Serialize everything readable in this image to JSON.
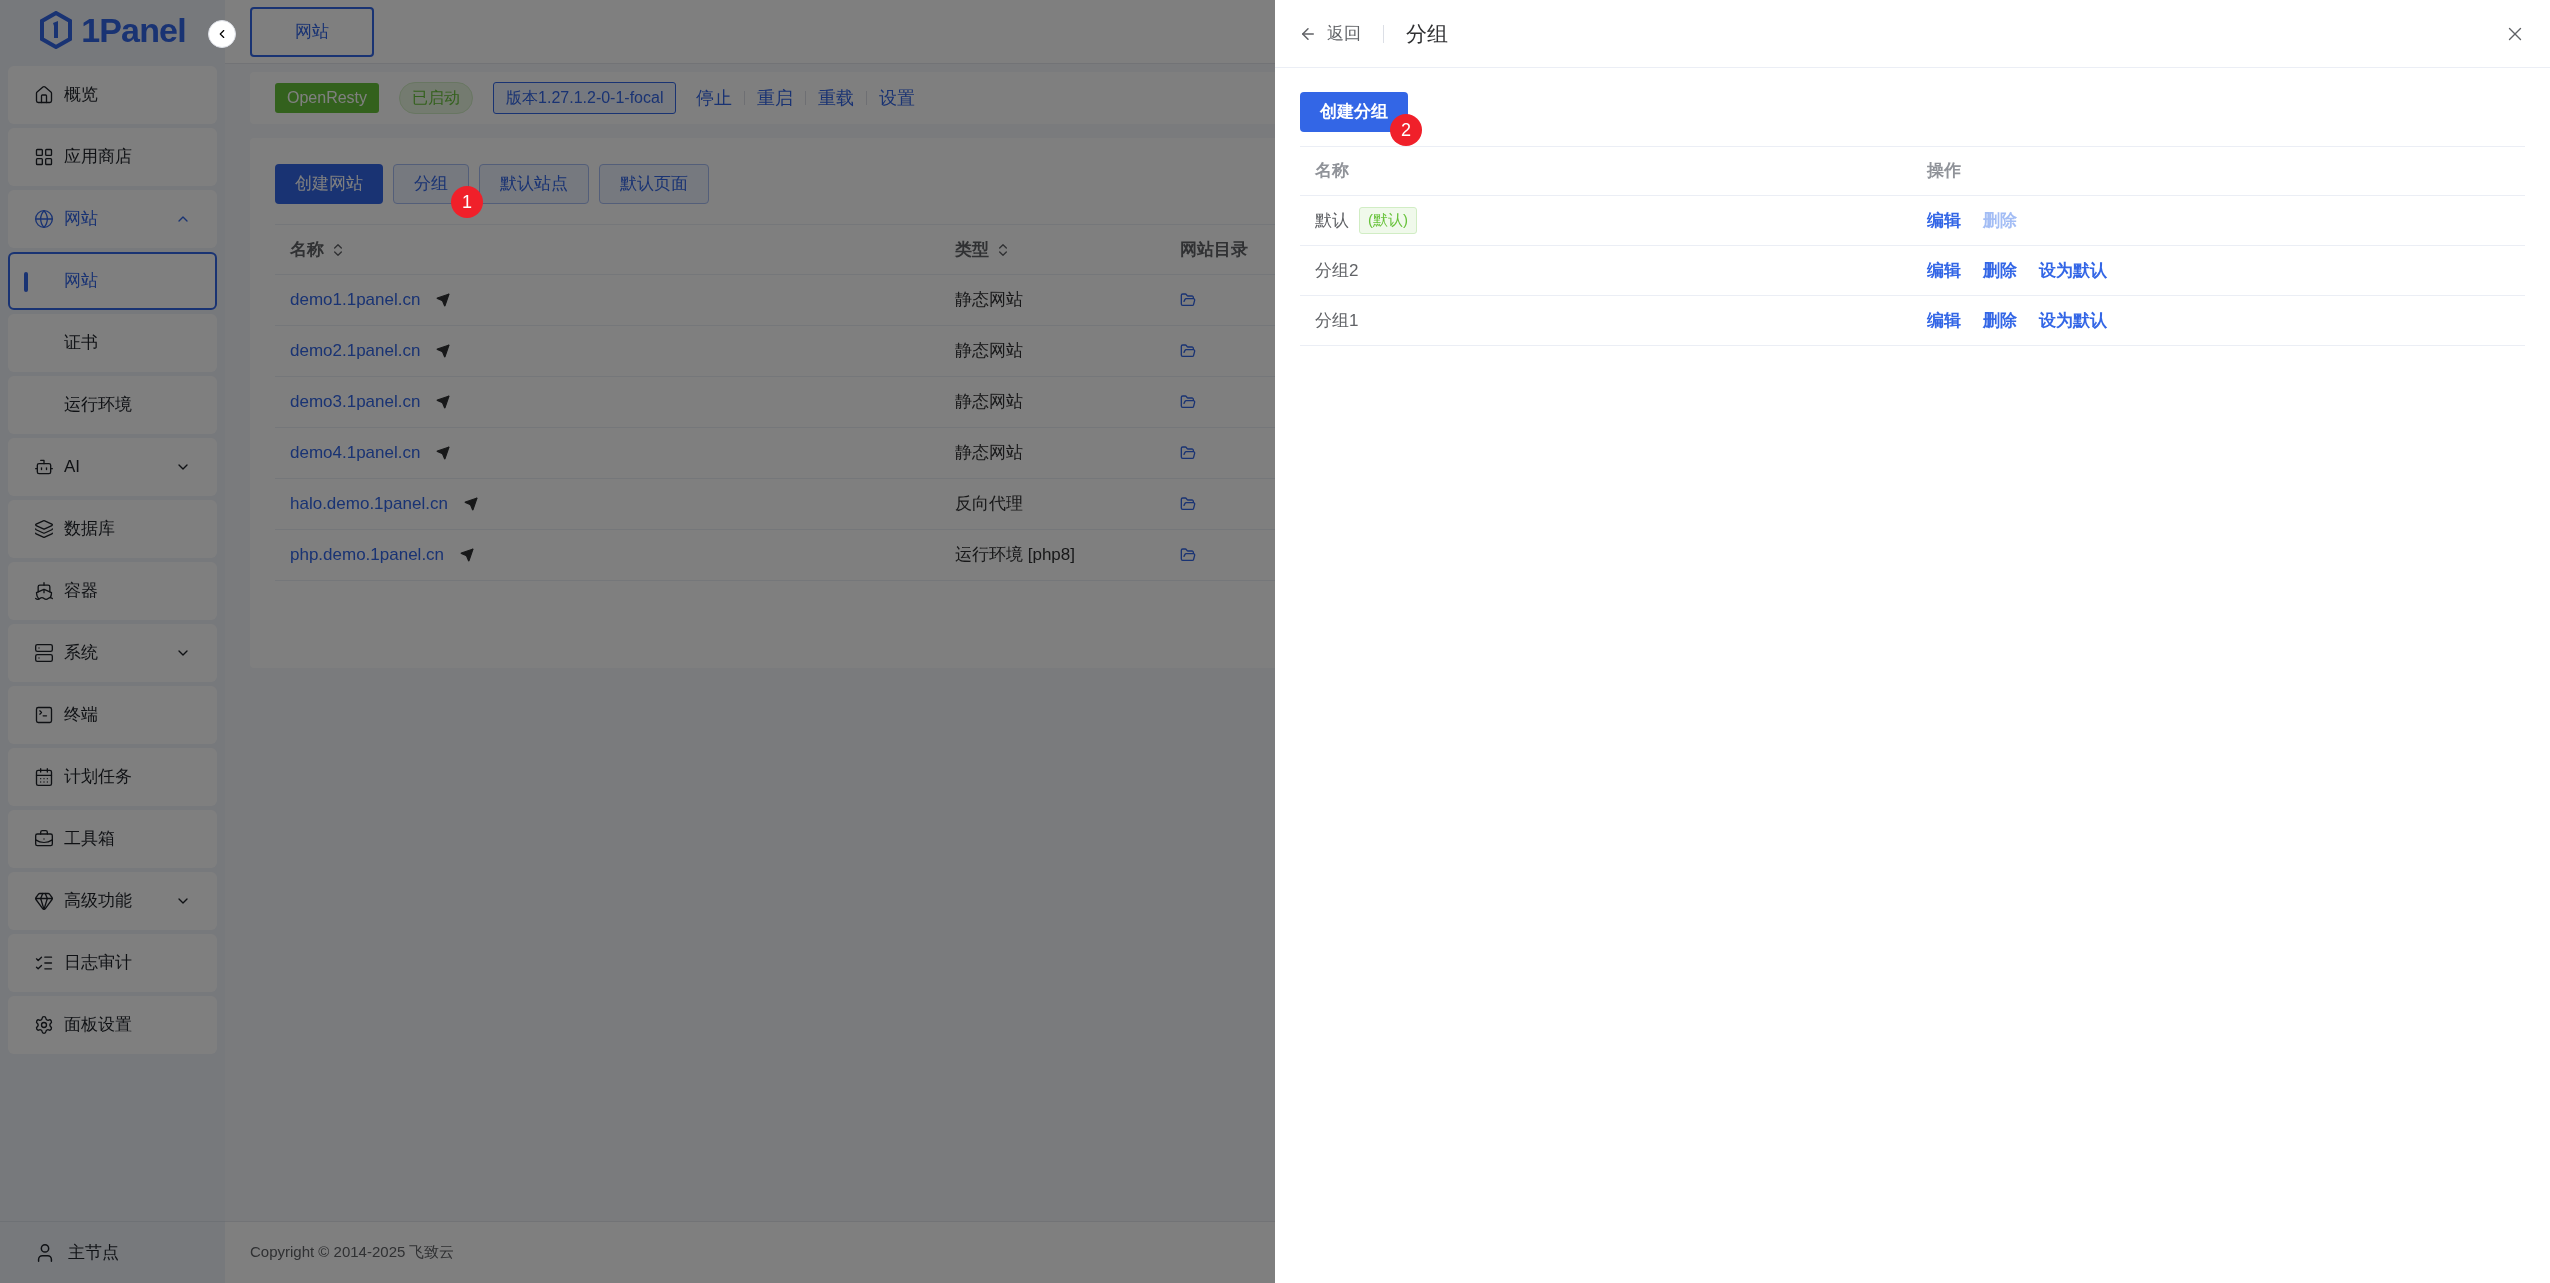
{
  "sidebar": {
    "logo": "1Panel",
    "items": [
      {
        "label": "概览",
        "selected": false
      },
      {
        "label": "应用商店",
        "selected": false
      },
      {
        "label": "网站",
        "selected": true,
        "expanded": true,
        "children": [
          {
            "label": "网站",
            "selected": true
          },
          {
            "label": "证书",
            "selected": false
          },
          {
            "label": "运行环境",
            "selected": false
          }
        ]
      },
      {
        "label": "AI",
        "selected": false,
        "expanded": false
      },
      {
        "label": "数据库",
        "selected": false
      },
      {
        "label": "容器",
        "selected": false
      },
      {
        "label": "系统",
        "selected": false,
        "expanded": false
      },
      {
        "label": "终端",
        "selected": false
      },
      {
        "label": "计划任务",
        "selected": false
      },
      {
        "label": "工具箱",
        "selected": false
      },
      {
        "label": "高级功能",
        "selected": false,
        "expanded": false
      },
      {
        "label": "日志审计",
        "selected": false
      },
      {
        "label": "面板设置",
        "selected": false
      }
    ],
    "node": "主节点"
  },
  "tabs": [
    {
      "label": "网站",
      "selected": true
    }
  ],
  "status_bar": {
    "app": "OpenResty",
    "status": "已启动",
    "version": "版本1.27.1.2-0-1-focal",
    "actions": [
      "停止",
      "重启",
      "重载",
      "设置"
    ]
  },
  "toolbar": [
    {
      "label": "创建网站",
      "kind": "primary"
    },
    {
      "label": "分组",
      "kind": "default",
      "badge": "1"
    },
    {
      "label": "默认站点",
      "kind": "default"
    },
    {
      "label": "默认页面",
      "kind": "default"
    }
  ],
  "table": {
    "columns": [
      {
        "label": "名称",
        "sortable": true
      },
      {
        "label": "类型",
        "sortable": true
      },
      {
        "label": "网站目录",
        "sortable": false
      }
    ],
    "rows": [
      {
        "name": "demo1.1panel.cn",
        "type": "静态网站"
      },
      {
        "name": "demo2.1panel.cn",
        "type": "静态网站"
      },
      {
        "name": "demo3.1panel.cn",
        "type": "静态网站"
      },
      {
        "name": "demo4.1panel.cn",
        "type": "静态网站"
      },
      {
        "name": "halo.demo.1panel.cn",
        "type": "反向代理"
      },
      {
        "name": "php.demo.1panel.cn",
        "type": "运行环境 [php8]"
      }
    ]
  },
  "footer": "Copyright © 2014-2025 飞致云",
  "drawer": {
    "back": "返回",
    "title": "分组",
    "create_button": {
      "label": "创建分组",
      "badge": "2"
    },
    "columns": [
      "名称",
      "操作"
    ],
    "rows": [
      {
        "name": "默认",
        "tag": "(默认)",
        "actions": [
          {
            "label": "编辑",
            "disabled": false
          },
          {
            "label": "删除",
            "disabled": true
          }
        ]
      },
      {
        "name": "分组2",
        "actions": [
          {
            "label": "编辑",
            "disabled": false
          },
          {
            "label": "删除",
            "disabled": false
          },
          {
            "label": "设为默认",
            "disabled": false
          }
        ]
      },
      {
        "name": "分组1",
        "actions": [
          {
            "label": "编辑",
            "disabled": false
          },
          {
            "label": "删除",
            "disabled": false
          },
          {
            "label": "设为默认",
            "disabled": false
          }
        ]
      }
    ]
  }
}
